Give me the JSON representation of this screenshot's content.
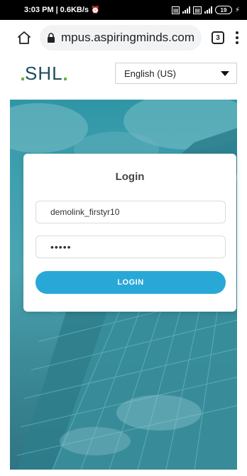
{
  "status_bar": {
    "time": "3:03 PM",
    "speed": "0.6KB/s",
    "battery": "19"
  },
  "browser": {
    "url": "mpus.aspiringminds.com",
    "tab_count": "3"
  },
  "header": {
    "logo": "SHL",
    "language": "English (US)"
  },
  "login": {
    "title": "Login",
    "username_value": "demolink_firstyr10",
    "password_value": "•••••",
    "button_label": "LOGIN"
  },
  "colors": {
    "accent": "#29a8d8",
    "logo": "#1d4d5c",
    "logo_dot": "#6fb23f",
    "hero": "#3f9fae"
  }
}
